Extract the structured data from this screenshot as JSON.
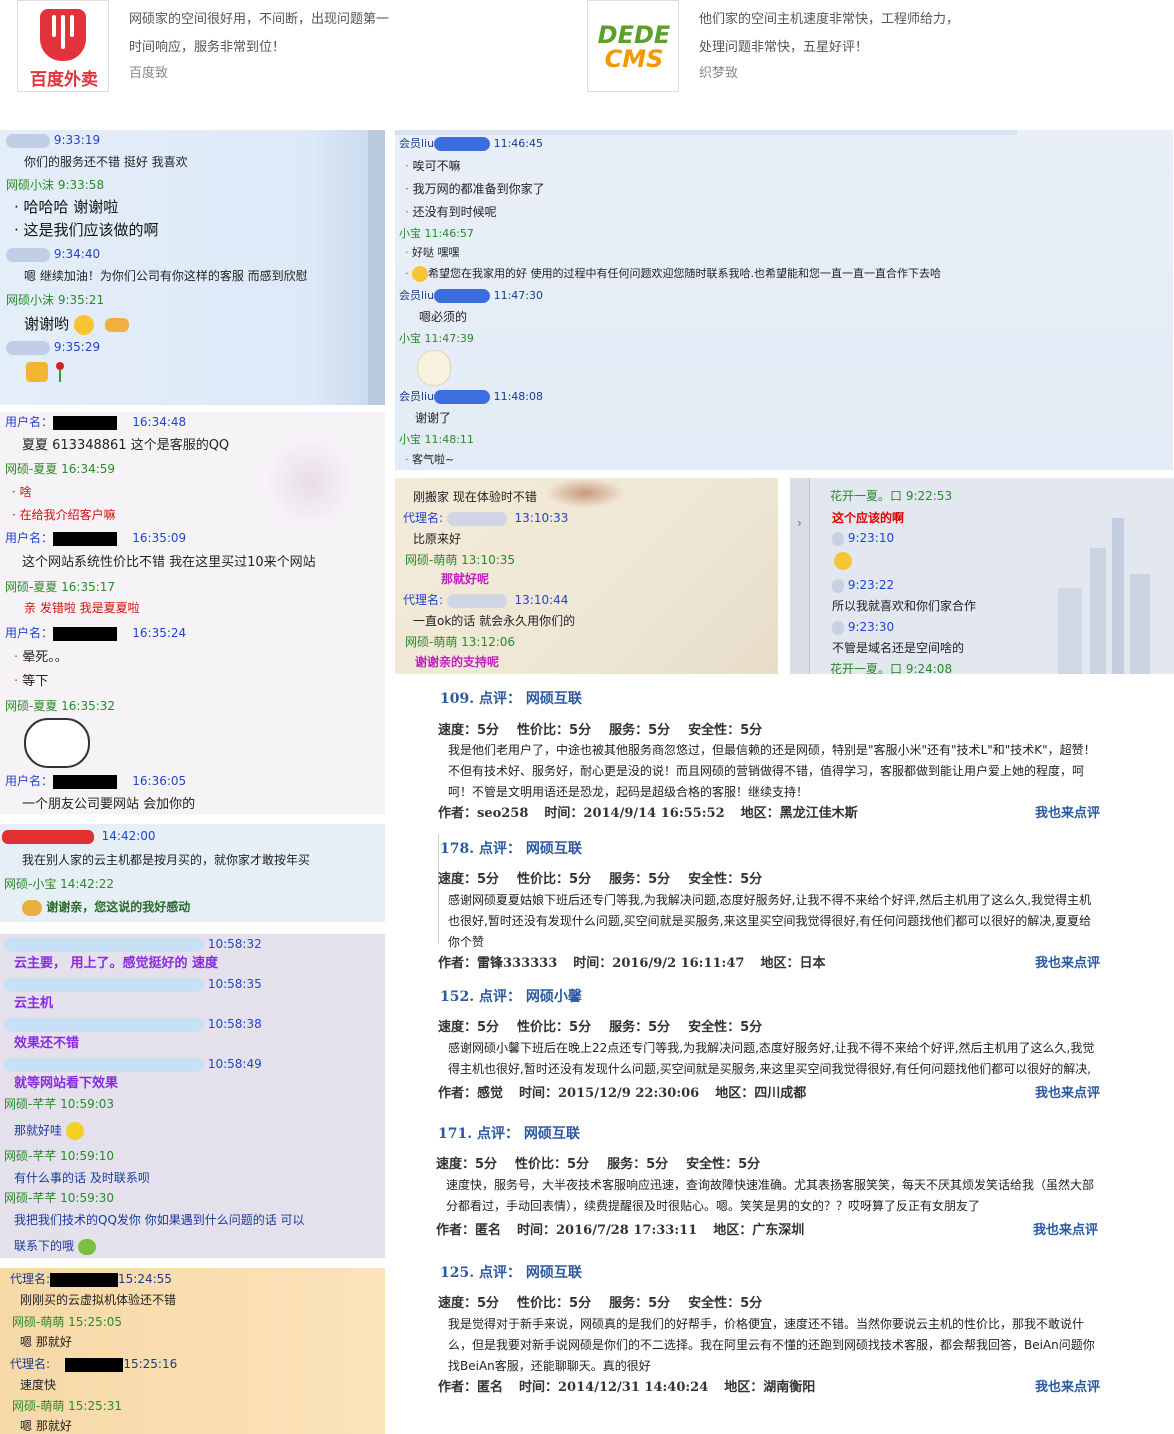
{
  "testimonials": [
    {
      "logo_text": "百度外卖",
      "text_line1": "网硕家的空间很好用，不间断，出现问题第一",
      "text_line2": "时间响应，服务非常到位！",
      "author": "百度致"
    },
    {
      "logo_text_1": "DEDE",
      "logo_text_2": "CMS",
      "text_line1": "他们家的空间主机速度非常快，工程师给力，",
      "text_line2": "处理问题非常快，五星好评！",
      "author": "织梦致"
    }
  ],
  "chat1": {
    "lines": [
      {
        "t": "9:33:19"
      },
      {
        "t": "你们的服务还不错  挺好  我喜欢"
      },
      {
        "t": "网硕小沫   9:33:58"
      },
      {
        "t": "· 哈哈哈    谢谢啦"
      },
      {
        "t": "· 这是我们应该做的啊"
      },
      {
        "t": "9:34:40"
      },
      {
        "t": "嗯  继续加油！为你们公司有你这样的客服 而感到欣慰"
      },
      {
        "t": "网硕小沫  9:35:21"
      },
      {
        "t": "谢谢哟"
      },
      {
        "t": "9:35:29"
      }
    ]
  },
  "chat2": {
    "lines": [
      {
        "t": "会员liu"
      },
      {
        "t": "11:46:45"
      },
      {
        "t": "唉可不嘛"
      },
      {
        "t": "我万网的都准备到你家了"
      },
      {
        "t": "还没有到时候呢"
      },
      {
        "t": "小宝  11:46:57"
      },
      {
        "t": "好哒 嘿嘿"
      },
      {
        "t": "希望您在我家用的好 使用的过程中有任何问题欢迎您随时联系我哈.也希望能和您一直一直一直合作下去哈"
      },
      {
        "t": "会员liu"
      },
      {
        "t": "11:47:30"
      },
      {
        "t": "嗯必须的"
      },
      {
        "t": "小宝  11:47:39"
      },
      {
        "t": "会员liu"
      },
      {
        "t": "11:48:08"
      },
      {
        "t": "谢谢了"
      },
      {
        "t": "小宝  11:48:11"
      },
      {
        "t": "客气啦~"
      }
    ]
  },
  "chat3": {
    "lines": [
      {
        "t": "用户名："
      },
      {
        "t": "16:34:48"
      },
      {
        "t": "夏夏  613348861 这个是客服的QQ"
      },
      {
        "t": "网硕-夏夏   16:34:59"
      },
      {
        "t": "啥"
      },
      {
        "t": "在给我介绍客户嘛"
      },
      {
        "t": "用户名："
      },
      {
        "t": "16:35:09"
      },
      {
        "t": "这个网站系统性价比不错   我在这里买过10来个网站"
      },
      {
        "t": "网硕-夏夏   16:35:17"
      },
      {
        "t": "亲  发错啦  我是夏夏啦"
      },
      {
        "t": "用户名："
      },
      {
        "t": "16:35:24"
      },
      {
        "t": "晕死。。"
      },
      {
        "t": "等下"
      },
      {
        "t": "网硕-夏夏   16:35:32"
      },
      {
        "t": "用户名："
      },
      {
        "t": "16:36:05"
      },
      {
        "t": "一个朋友公司要网站  会加你的"
      }
    ]
  },
  "chat4": {
    "lines": [
      {
        "t": "刚搬家  现在体验时不错"
      },
      {
        "t": "代理名:"
      },
      {
        "t": "13:10:33"
      },
      {
        "t": "比原来好"
      },
      {
        "t": "网硕-萌萌 13:10:35"
      },
      {
        "t": "那就好呢"
      },
      {
        "t": "代理名:"
      },
      {
        "t": "13:10:44"
      },
      {
        "t": "一直ok的话  就会永久用你们的"
      },
      {
        "t": "网硕-萌萌 13:12:06"
      },
      {
        "t": "谢谢亲的支持呢"
      }
    ]
  },
  "chat5": {
    "lines": [
      {
        "t": "花开一夏。口 9:22:53"
      },
      {
        "t": "这个应该的啊"
      },
      {
        "t": "9:23:10"
      },
      {
        "t": "9:23:22"
      },
      {
        "t": "所以我就喜欢和你们家合作"
      },
      {
        "t": "9:23:30"
      },
      {
        "t": "不管是域名还是空间啥的"
      },
      {
        "t": "花开一夏。口 9:24:08"
      }
    ]
  },
  "chat6": {
    "lines": [
      {
        "t": "14:42:00"
      },
      {
        "t": "我在别人家的云主机都是按月买的，就你家才敢按年买"
      },
      {
        "t": "网硕-小宝   14:42:22"
      },
      {
        "t": "谢谢亲，您这说的我好感动"
      }
    ]
  },
  "chat7": {
    "lines": [
      {
        "t": "10:58:32"
      },
      {
        "t": "云主要，  用上了。感觉挺好的  速度"
      },
      {
        "t": "10:58:35"
      },
      {
        "t": "云主机"
      },
      {
        "t": "10:58:38"
      },
      {
        "t": "效果还不错"
      },
      {
        "t": "10:58:49"
      },
      {
        "t": "就等网站看下效果"
      },
      {
        "t": "网硕-芊芊 10:59:03"
      },
      {
        "t": "那就好哇"
      },
      {
        "t": "网硕-芊芊 10:59:10"
      },
      {
        "t": "有什么事的话 及时联系呗"
      },
      {
        "t": "网硕-芊芊 10:59:30"
      },
      {
        "t": "我把我们技术的QQ发你 你如果遇到什么问题的话 可以"
      },
      {
        "t": "联系下的哦"
      }
    ]
  },
  "chat8": {
    "lines": [
      {
        "t": "代理名:"
      },
      {
        "t": "15:24:55"
      },
      {
        "t": "刚刚买的云虚拟机体验还不错"
      },
      {
        "t": "网硕-萌萌 15:25:05"
      },
      {
        "t": "嗯 那就好"
      },
      {
        "t": "代理名:"
      },
      {
        "t": "15:25:16"
      },
      {
        "t": "速度快"
      },
      {
        "t": "网硕-萌萌 15:25:31"
      },
      {
        "t": "嗯 那就好"
      }
    ]
  },
  "reviews": [
    {
      "title": "109. 点评： 网硕互联",
      "speed": "速度：5分",
      "value": "性价比：5分",
      "service": "服务：5分",
      "safety": "安全性：5分",
      "body": "我是他们老用户了，中途也被其他服务商忽悠过，但最信赖的还是网硕，特别是\"客服小米\"还有\"技术L\"和\"技术K\"，超赞！不但有技术好、服务好，耐心更是没的说！而且网硕的营销做得不错，值得学习，客服都做到能让用户爱上她的程度，呵呵！不管是文明用语还是恐龙，起码是超级合格的客服！继续支持！",
      "author": "作者：seo258",
      "time": "时间：2014/9/14 16:55:52",
      "region": "地区：黑龙江佳木斯",
      "link": "我也来点评"
    },
    {
      "title": "178. 点评： 网硕互联",
      "speed": "速度：5分",
      "value": "性价比：5分",
      "service": "服务：5分",
      "safety": "安全性：5分",
      "body": "感谢网硕夏夏姑娘下班后还专门等我,为我解决问题,态度好服务好,让我不得不来给个好评,然后主机用了这么久,我觉得主机也很好,暂时还没有发现什么问题,买空间就是买服务,来这里买空间我觉得很好,有任何问题找他们都可以很好的解决,夏夏给你个赞",
      "author": "作者：雷锋333333",
      "time": "时间：2016/9/2 16:11:47",
      "region": "地区：日本",
      "link": "我也来点评"
    },
    {
      "title": "152. 点评： 网硕小馨",
      "speed": "速度：5分",
      "value": "性价比：5分",
      "service": "服务：5分",
      "safety": "安全性：5分",
      "body": "感谢网硕小馨下班后在晚上22点还专门等我,为我解决问题,态度好服务好,让我不得不来给个好评,然后主机用了这么久,我觉得主机也很好,暂时还没有发现什么问题,买空间就是买服务,来这里买空间我觉得很好,有任何问题找他们都可以很好的解决,",
      "author": "作者：感觉",
      "time": "时间：2015/12/9 22:30:06",
      "region": "地区：四川成都",
      "link": "我也来点评"
    },
    {
      "title": "171. 点评： 网硕互联",
      "speed": "速度：5分",
      "value": "性价比：5分",
      "service": "服务：5分",
      "safety": "安全性：5分",
      "body": "速度快，服务号，大半夜技术客服响应迅速，查询故障快速准确。尤其表扬客服笑笑，每天不厌其烦发笑话给我（虽然大部分都看过，手动回表情），续费提醒很及时很贴心。嗯。笑笑是男的女的？？哎呀算了反正有女朋友了",
      "author": "作者：匿名",
      "time": "时间：2016/7/28 17:33:11",
      "region": "地区：广东深圳",
      "link": "我也来点评"
    },
    {
      "title": "125. 点评： 网硕互联",
      "speed": "速度：5分",
      "value": "性价比：5分",
      "service": "服务：5分",
      "safety": "安全性：5分",
      "body": "我是觉得对于新手来说，网硕真的是我们的好帮手，价格便宜，速度还不错。当然你要说云主机的性价比，那我不敢说什么，但是我要对新手说网硕是你们的不二选择。我在阿里云有不懂的还跑到网硕找技术客服，都会帮我回答，BeiAn问题你找BeiAn客服，还能聊聊天。真的很好",
      "author": "作者：匿名",
      "time": "时间：2014/12/31 14:40:24",
      "region": "地区：湖南衡阳",
      "link": "我也来点评"
    }
  ],
  "colors": {
    "link": "#2c5aa0",
    "green_meta": "#2a8a2a",
    "blue_meta": "#2244cc",
    "red_msg": "#d01010"
  }
}
